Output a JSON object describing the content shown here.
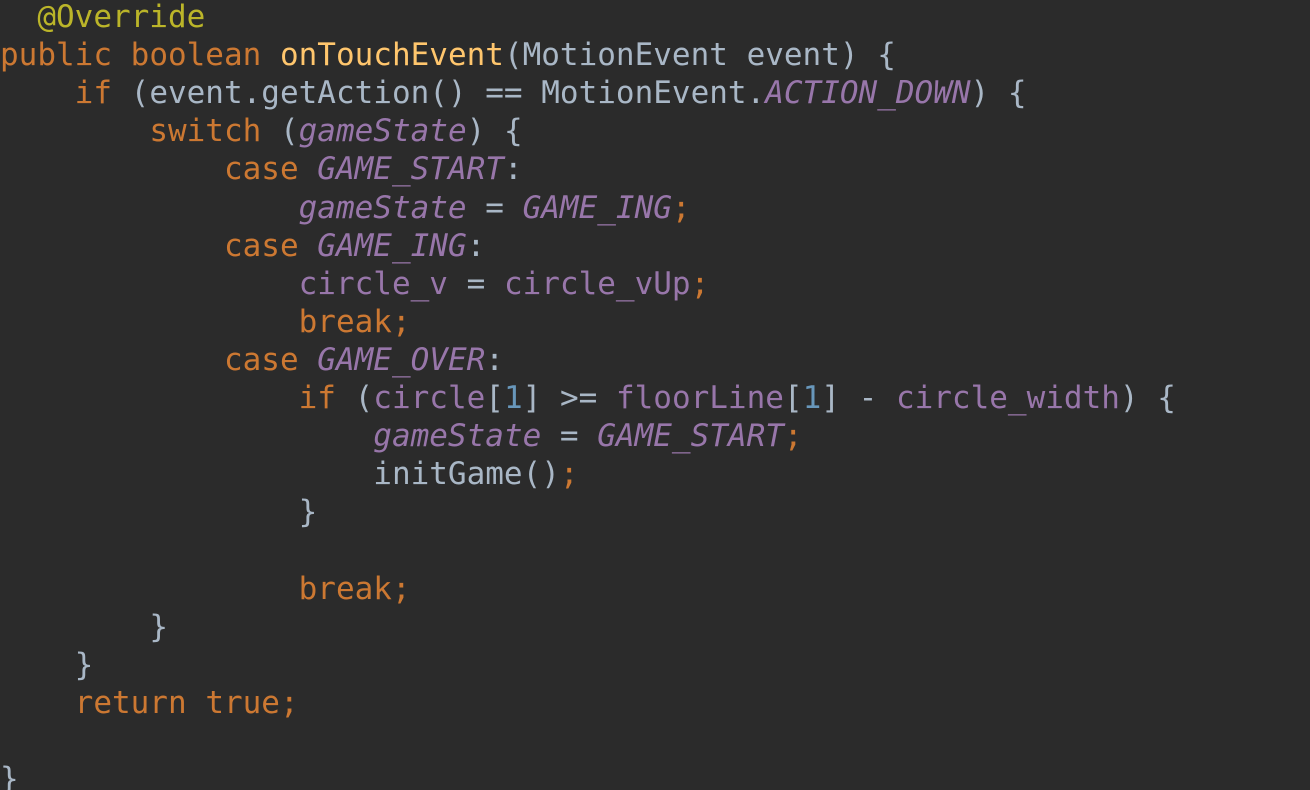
{
  "editor": {
    "colors": {
      "background": "#2b2b2b",
      "plain": "#a9b7c6",
      "keyword": "#cc7832",
      "annotation": "#bbb529",
      "method": "#ffc66d",
      "field": "#9876aa",
      "static": "#9876aa",
      "number": "#6897bb"
    },
    "lines": [
      {
        "indent": "  ",
        "tokens": [
          {
            "t": "annotation",
            "v": "@Override"
          }
        ]
      },
      {
        "indent": "",
        "tokens": [
          {
            "t": "keyword",
            "v": "public "
          },
          {
            "t": "keyword",
            "v": "boolean "
          },
          {
            "t": "method",
            "v": "onTouchEvent"
          },
          {
            "t": "plain",
            "v": "(MotionEvent event) {"
          }
        ]
      },
      {
        "indent": "    ",
        "tokens": [
          {
            "t": "keyword",
            "v": "if "
          },
          {
            "t": "plain",
            "v": "(event.getAction() == MotionEvent."
          },
          {
            "t": "static",
            "v": "ACTION_DOWN"
          },
          {
            "t": "plain",
            "v": ") {"
          }
        ]
      },
      {
        "indent": "        ",
        "tokens": [
          {
            "t": "keyword",
            "v": "switch "
          },
          {
            "t": "plain",
            "v": "("
          },
          {
            "t": "static",
            "v": "gameState"
          },
          {
            "t": "plain",
            "v": ") {"
          }
        ]
      },
      {
        "indent": "            ",
        "tokens": [
          {
            "t": "keyword",
            "v": "case "
          },
          {
            "t": "static",
            "v": "GAME_START"
          },
          {
            "t": "plain",
            "v": ":"
          }
        ]
      },
      {
        "indent": "                ",
        "tokens": [
          {
            "t": "static",
            "v": "gameState"
          },
          {
            "t": "plain",
            "v": " = "
          },
          {
            "t": "static",
            "v": "GAME_ING"
          },
          {
            "t": "punct",
            "v": ";"
          }
        ]
      },
      {
        "indent": "            ",
        "tokens": [
          {
            "t": "keyword",
            "v": "case "
          },
          {
            "t": "static",
            "v": "GAME_ING"
          },
          {
            "t": "plain",
            "v": ":"
          }
        ]
      },
      {
        "indent": "                ",
        "tokens": [
          {
            "t": "field",
            "v": "circle_v"
          },
          {
            "t": "plain",
            "v": " = "
          },
          {
            "t": "field",
            "v": "circle_vUp"
          },
          {
            "t": "punct",
            "v": ";"
          }
        ]
      },
      {
        "indent": "                ",
        "tokens": [
          {
            "t": "keyword",
            "v": "break;"
          }
        ]
      },
      {
        "indent": "            ",
        "tokens": [
          {
            "t": "keyword",
            "v": "case "
          },
          {
            "t": "static",
            "v": "GAME_OVER"
          },
          {
            "t": "plain",
            "v": ":"
          }
        ]
      },
      {
        "indent": "                ",
        "tokens": [
          {
            "t": "keyword",
            "v": "if "
          },
          {
            "t": "plain",
            "v": "("
          },
          {
            "t": "field",
            "v": "circle"
          },
          {
            "t": "plain",
            "v": "["
          },
          {
            "t": "number",
            "v": "1"
          },
          {
            "t": "plain",
            "v": "] >= "
          },
          {
            "t": "field",
            "v": "floorLine"
          },
          {
            "t": "plain",
            "v": "["
          },
          {
            "t": "number",
            "v": "1"
          },
          {
            "t": "plain",
            "v": "] - "
          },
          {
            "t": "field",
            "v": "circle_width"
          },
          {
            "t": "plain",
            "v": ") {"
          }
        ]
      },
      {
        "indent": "                    ",
        "tokens": [
          {
            "t": "static",
            "v": "gameState"
          },
          {
            "t": "plain",
            "v": " = "
          },
          {
            "t": "static",
            "v": "GAME_START"
          },
          {
            "t": "punct",
            "v": ";"
          }
        ]
      },
      {
        "indent": "                    ",
        "tokens": [
          {
            "t": "plain",
            "v": "initGame()"
          },
          {
            "t": "punct",
            "v": ";"
          }
        ]
      },
      {
        "indent": "                ",
        "tokens": [
          {
            "t": "plain",
            "v": "}"
          }
        ]
      },
      {
        "indent": "",
        "tokens": []
      },
      {
        "indent": "                ",
        "tokens": [
          {
            "t": "keyword",
            "v": "break;"
          }
        ]
      },
      {
        "indent": "        ",
        "tokens": [
          {
            "t": "plain",
            "v": "}"
          }
        ]
      },
      {
        "indent": "    ",
        "tokens": [
          {
            "t": "plain",
            "v": "}"
          }
        ]
      },
      {
        "indent": "    ",
        "tokens": [
          {
            "t": "keyword",
            "v": "return "
          },
          {
            "t": "keyword",
            "v": "true;"
          }
        ]
      },
      {
        "indent": "",
        "tokens": []
      },
      {
        "indent": "",
        "tokens": [
          {
            "t": "plain",
            "v": "}"
          }
        ]
      }
    ]
  }
}
